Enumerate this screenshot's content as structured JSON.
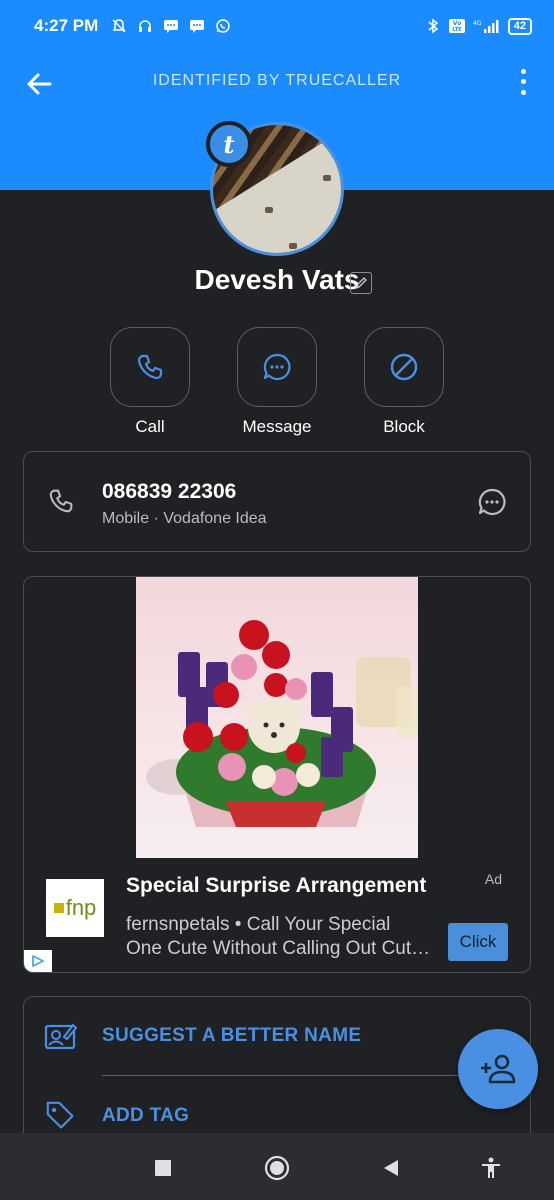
{
  "status_bar": {
    "time": "4:27 PM",
    "battery": "42"
  },
  "header": {
    "title": "IDENTIFIED BY TRUECALLER"
  },
  "contact": {
    "name": "Devesh Vats",
    "badge_letter": "t"
  },
  "actions": [
    {
      "label": "Call",
      "icon": "phone-icon"
    },
    {
      "label": "Message",
      "icon": "chat-icon"
    },
    {
      "label": "Block",
      "icon": "block-icon"
    }
  ],
  "phone": {
    "number": "086839 22306",
    "meta": "Mobile · Vodafone Idea"
  },
  "ad": {
    "title": "Special Surprise Arrangement",
    "tag": "Ad",
    "advertiser_logo_text": "fnp",
    "body_line1": "fernsnpetals • Call Your Special",
    "body_line2": "One Cute Without Calling Out Cut…",
    "cta": "Click"
  },
  "options": [
    {
      "label": "SUGGEST A BETTER NAME",
      "icon": "suggest-name-icon"
    },
    {
      "label": "ADD TAG",
      "icon": "tag-icon"
    }
  ],
  "colors": {
    "header_blue": "#1a8cff",
    "accent": "#4a90e2",
    "background": "#202124"
  }
}
